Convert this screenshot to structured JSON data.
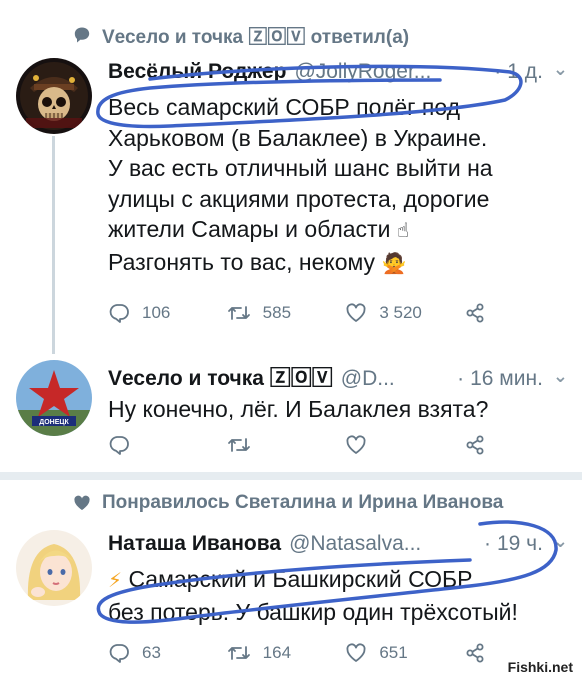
{
  "colors": {
    "meta_grey": "#657786",
    "text": "#14171a",
    "divider": "#e6ecf0",
    "scribble": "#3d62c8"
  },
  "context_reply": {
    "icon": "speech-bubble-icon",
    "text": "Vесело и точка 🅉🄾🅅 ответил(а)"
  },
  "tweet1": {
    "name": "Весёлый Роджер",
    "handle": "@JollyRoger...",
    "dot": "·",
    "time": "1 д.",
    "more": "⌄",
    "lines": [
      "Весь самарский СОБР полёг под",
      "Харьковом (в Балаклее) в Украине.",
      "У вас есть отличный шанс выйти на",
      "улицы с акциями протеста, дорогие",
      "жители Самары и области",
      "Разгонять то вас, некому"
    ],
    "emoji_point": "☝",
    "emoji_person": "🙅",
    "replies": "106",
    "retweets": "585",
    "likes": "3 520"
  },
  "tweet2": {
    "name": "Vесело и точка 🅉🄾🅅",
    "handle": "@D...",
    "dot": "·",
    "time": "16 мин.",
    "more": "⌄",
    "lines": [
      "Ну конечно, лёг. И Балаклея взята?"
    ],
    "avatar_caption": "ДОНЕЦК"
  },
  "context_like": {
    "icon": "heart-icon",
    "text": "Понравилось Светалина и Ирина Иванова"
  },
  "tweet3": {
    "name": "Наташа Иванова",
    "handle": "@Natasalva...",
    "dot": "·",
    "time": "19 ч.",
    "more": "⌄",
    "emoji_bolt": "⚡",
    "lines": [
      "Самарский и Башкирский СОБР",
      "без потерь. У башкир один трёхсотый!"
    ],
    "replies": "63",
    "retweets": "164",
    "likes": "651"
  },
  "watermark": "Fishki.net"
}
